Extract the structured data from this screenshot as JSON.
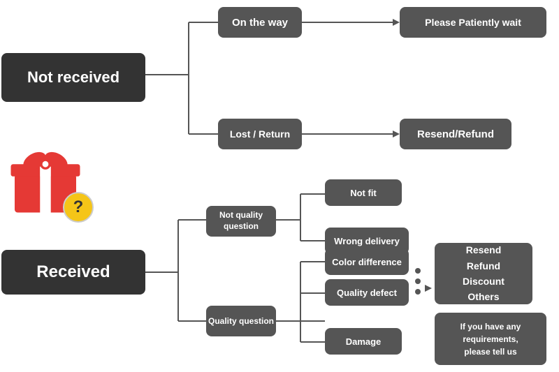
{
  "boxes": {
    "not_received": {
      "label": "Not received"
    },
    "on_the_way": {
      "label": "On the way"
    },
    "please_wait": {
      "label": "Please Patiently wait"
    },
    "lost_return": {
      "label": "Lost / Return"
    },
    "resend_refund_1": {
      "label": "Resend/Refund"
    },
    "received": {
      "label": "Received"
    },
    "not_quality": {
      "label": "Not quality\nquestion"
    },
    "quality_q": {
      "label": "Quality question"
    },
    "not_fit": {
      "label": "Not fit"
    },
    "wrong_delivery": {
      "label": "Wrong delivery"
    },
    "color_diff": {
      "label": "Color difference"
    },
    "quality_defect": {
      "label": "Quality defect"
    },
    "damage": {
      "label": "Damage"
    },
    "resend_etc": {
      "label": "Resend\nRefund\nDiscount\nOthers"
    },
    "if_you": {
      "label": "If you have any\nrequirements,\nplease tell us"
    }
  },
  "colors": {
    "box_bg": "#555555",
    "box_large_bg": "#333333",
    "text_white": "#ffffff",
    "line_color": "#555555",
    "arrow_color": "#333333"
  }
}
